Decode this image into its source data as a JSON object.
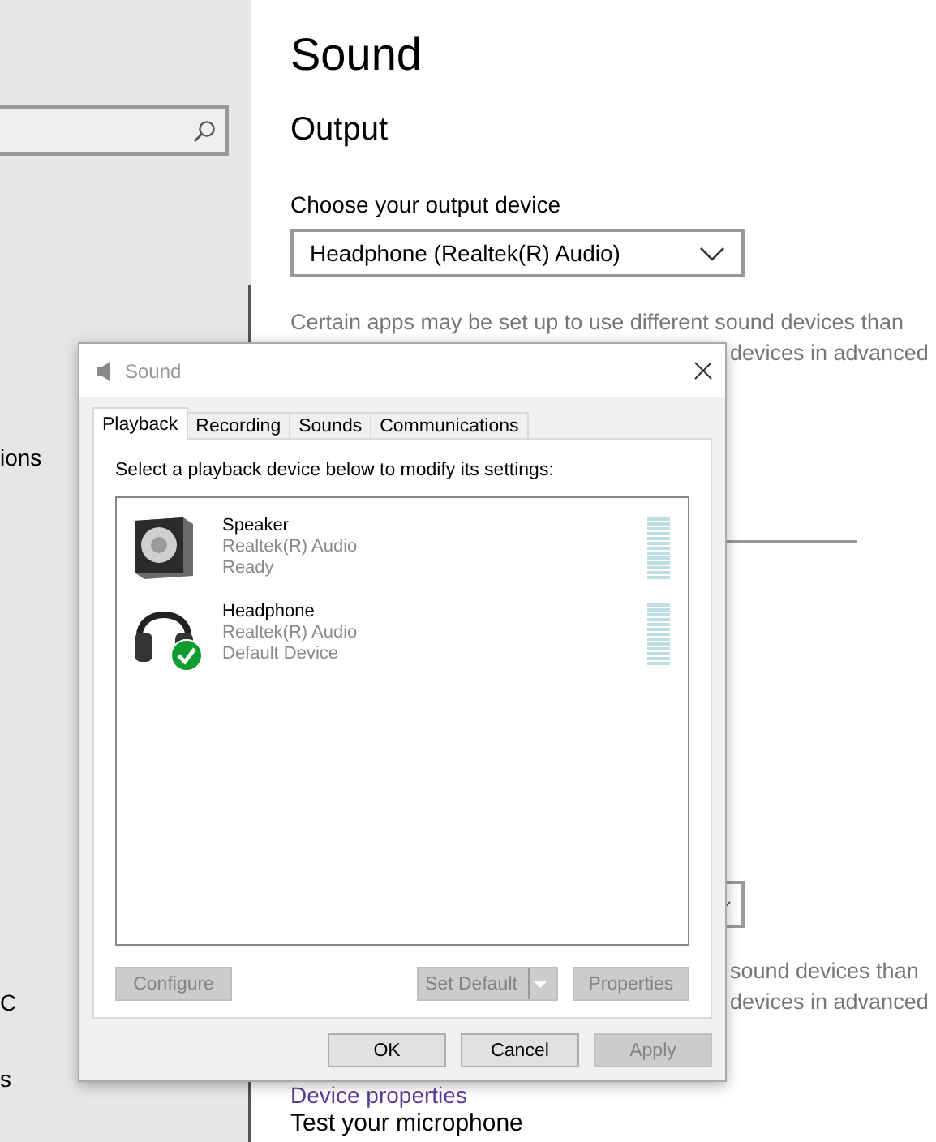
{
  "sidebar": {
    "items": [
      {
        "label": "ions"
      },
      {
        "label": "C"
      },
      {
        "label": "s"
      }
    ]
  },
  "page": {
    "title": "Sound",
    "section": "Output",
    "output_label": "Choose your output device",
    "output_device": "Headphone (Realtek(R) Audio)",
    "output_note": [
      "Certain apps may be set up to use different sound devices than",
      "devices in advanced"
    ],
    "input_note": [
      "sound devices than",
      "devices in advanced"
    ],
    "link": "Device properties",
    "next_heading": "Test your microphone"
  },
  "dialog": {
    "title": "Sound",
    "tabs": [
      {
        "label": "Playback",
        "selected": true
      },
      {
        "label": "Recording",
        "selected": false
      },
      {
        "label": "Sounds",
        "selected": false
      },
      {
        "label": "Communications",
        "selected": false
      }
    ],
    "instruction": "Select a playback device below to modify its settings:",
    "devices": [
      {
        "kind": "speaker",
        "name": "Speaker",
        "driver": "Realtek(R) Audio",
        "status": "Ready",
        "default": false
      },
      {
        "kind": "headphone",
        "name": "Headphone",
        "driver": "Realtek(R) Audio",
        "status": "Default Device",
        "default": true
      }
    ],
    "actions": [
      {
        "kind": "plain",
        "label": "Configure",
        "disabled": true
      },
      {
        "kind": "split",
        "label": "Set Default",
        "disabled": true
      },
      {
        "kind": "plain",
        "label": "Properties",
        "disabled": true
      }
    ],
    "footer": [
      {
        "label": "OK",
        "disabled": false
      },
      {
        "label": "Cancel",
        "disabled": false
      },
      {
        "label": "Apply",
        "disabled": true
      }
    ]
  }
}
